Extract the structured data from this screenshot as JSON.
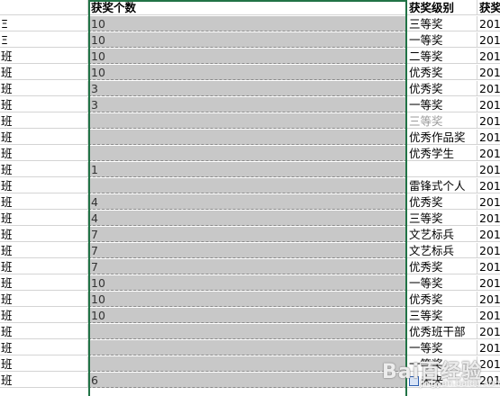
{
  "header": {
    "col_a": "",
    "col_b": "获奖个数",
    "col_c": "获奖级别",
    "col_d": "获奖"
  },
  "rows": [
    {
      "a": "Ξ",
      "b": "10",
      "c": "三等奖",
      "d": "201"
    },
    {
      "a": "Ξ",
      "b": "10",
      "c": "一等奖",
      "d": "201"
    },
    {
      "a": "班",
      "b": "10",
      "c": "二等奖",
      "d": "201"
    },
    {
      "a": "班",
      "b": "10",
      "c": "优秀奖",
      "d": "201"
    },
    {
      "a": "班",
      "b": "3",
      "c": "优秀奖",
      "d": "201"
    },
    {
      "a": "班",
      "b": "3",
      "c": "一等奖",
      "d": "201"
    },
    {
      "a": "班",
      "b": "",
      "c": "三等奖",
      "d": "201"
    },
    {
      "a": "班",
      "b": "",
      "c": "优秀作品奖",
      "d": "201"
    },
    {
      "a": "班",
      "b": "",
      "c": "优秀学生",
      "d": "201"
    },
    {
      "a": "班",
      "b": "1",
      "c": "",
      "d": "201"
    },
    {
      "a": "班",
      "b": "",
      "c": "雷锋式个人",
      "d": "201"
    },
    {
      "a": "班",
      "b": "4",
      "c": "优秀奖",
      "d": "201"
    },
    {
      "a": "班",
      "b": "4",
      "c": "三等奖",
      "d": "201"
    },
    {
      "a": "班",
      "b": "7",
      "c": "文艺标兵",
      "d": "201"
    },
    {
      "a": "班",
      "b": "7",
      "c": "文艺标兵",
      "d": "201"
    },
    {
      "a": "班",
      "b": "7",
      "c": "优秀奖",
      "d": "201"
    },
    {
      "a": "班",
      "b": "10",
      "c": "一等奖",
      "d": "201"
    },
    {
      "a": "班",
      "b": "10",
      "c": "优秀奖",
      "d": "201"
    },
    {
      "a": "班",
      "b": "10",
      "c": "三等奖",
      "d": "201"
    },
    {
      "a": "班",
      "b": "",
      "c": "优秀班干部",
      "d": "201"
    },
    {
      "a": "班",
      "b": "",
      "c": "一等奖",
      "d": "201"
    },
    {
      "a": "班",
      "b": "",
      "c": "一等奖",
      "d": "201"
    },
    {
      "a": "班",
      "b": "6",
      "c": "未来",
      "d": "201"
    }
  ],
  "watermark": {
    "text": "Bai百经验",
    "sub": "jingyan.baidu.com"
  },
  "colors": {
    "selection_fill": "#c8c8c8",
    "selection_border": "#217346",
    "grid": "#d4d4d4"
  }
}
